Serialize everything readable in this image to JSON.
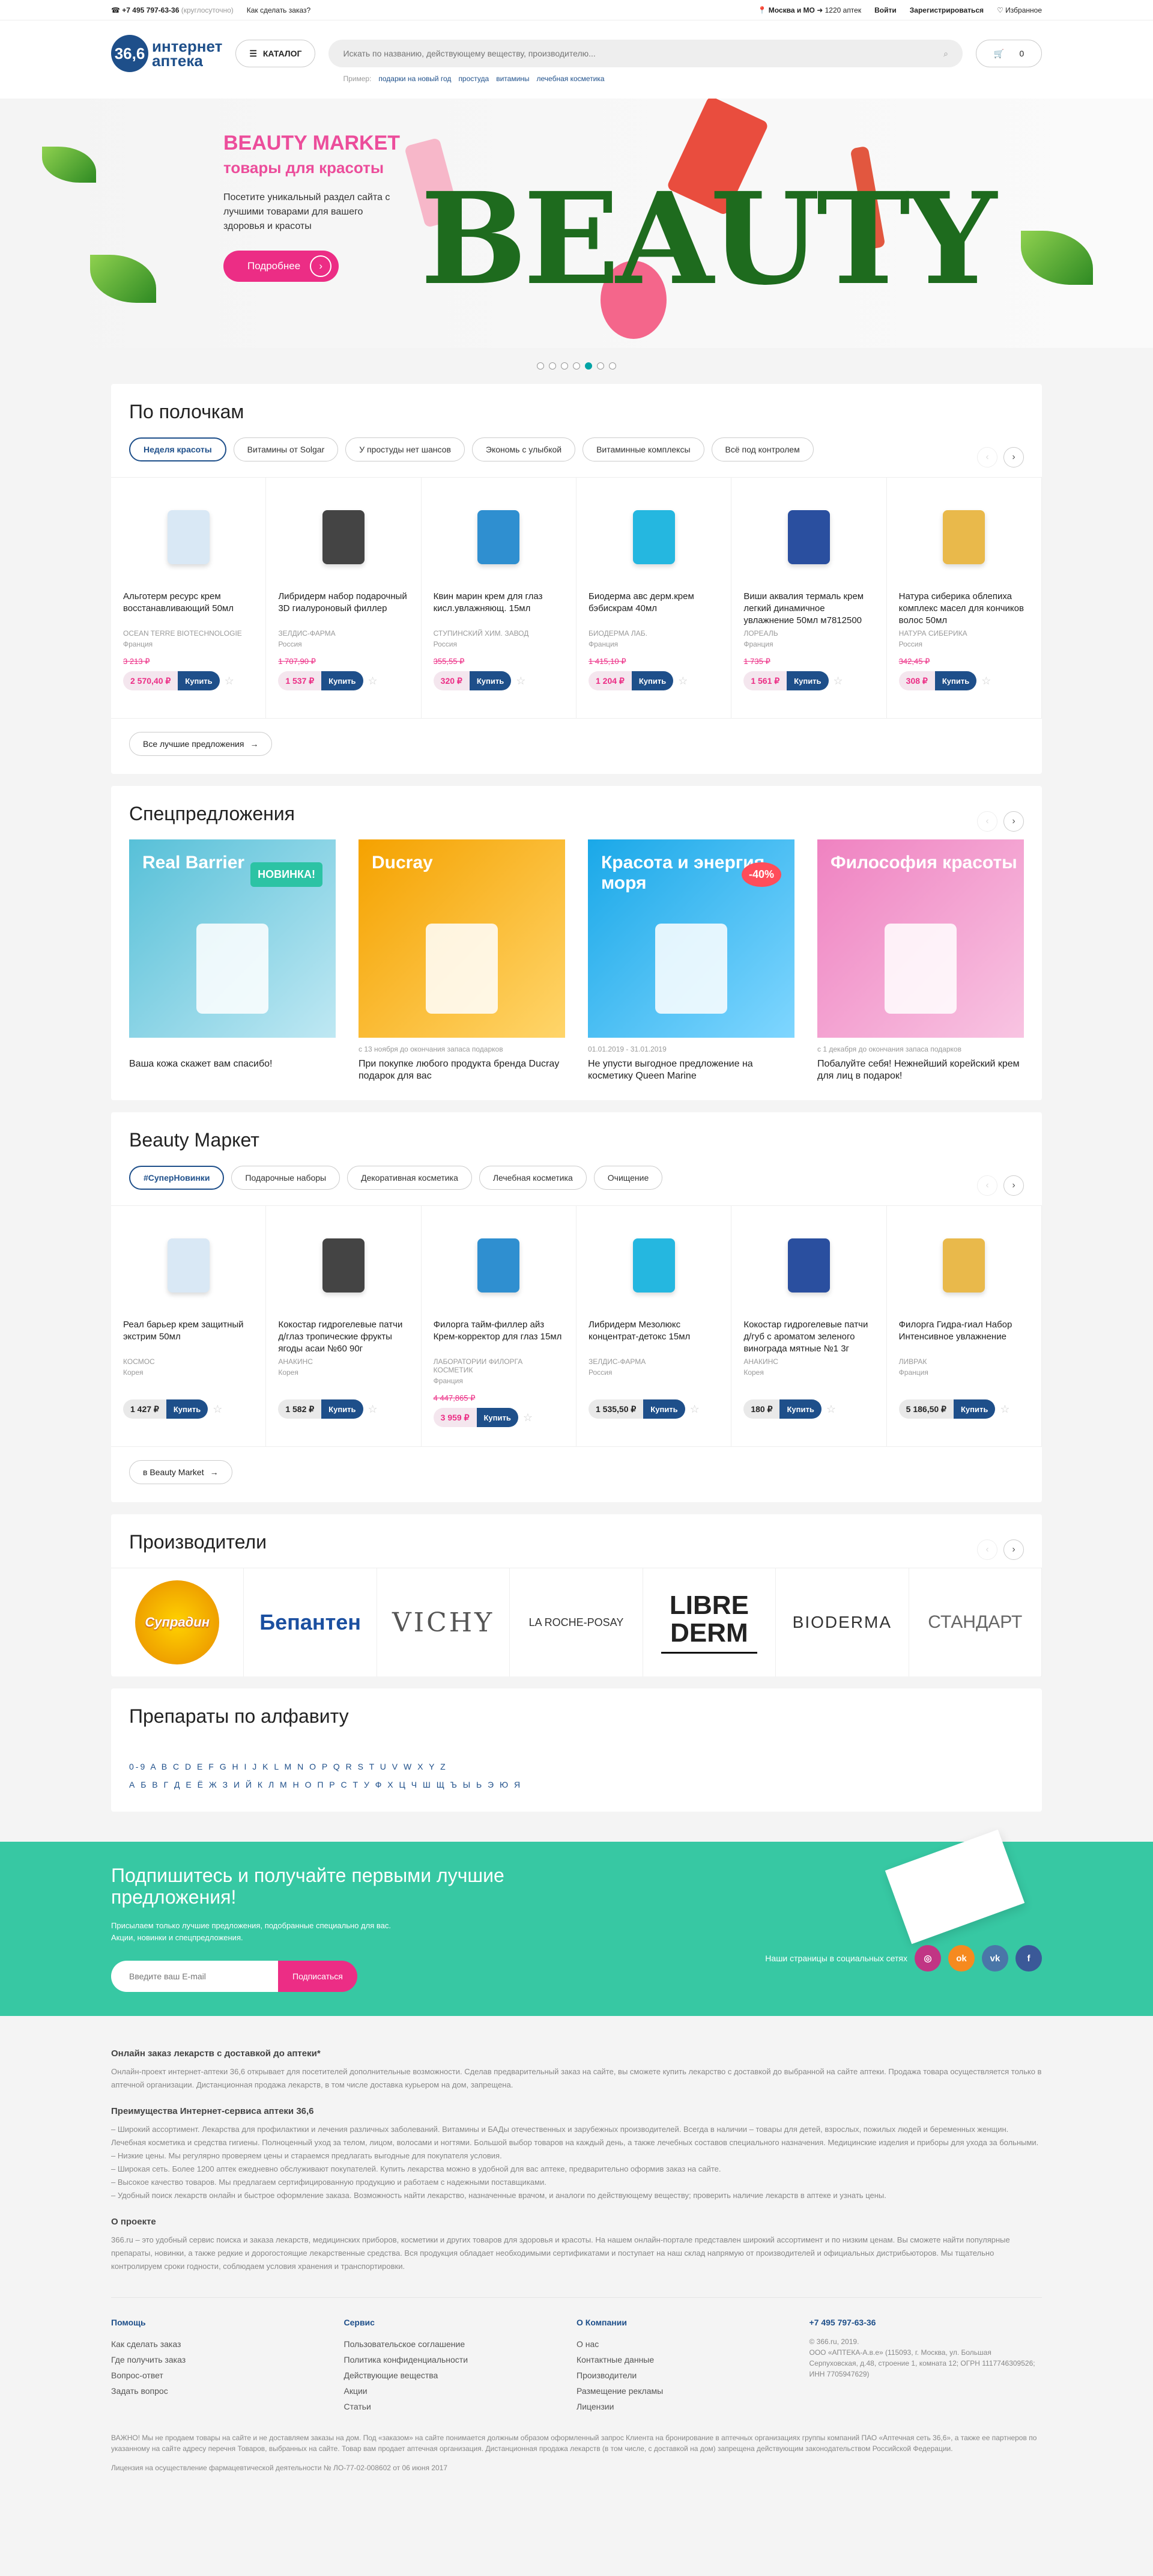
{
  "topbar": {
    "phone": "+7 495 797-63-36",
    "phone_note": "(круглосуточно)",
    "how_to_order": "Как сделать заказ?",
    "region": "Москва и МО",
    "pharmacies": "1220 аптек",
    "login": "Войти",
    "register": "Зарегистрироваться",
    "favorites": "Избранное"
  },
  "header": {
    "logo_num": "36,6",
    "logo_line1": "интернет",
    "logo_line2": "аптека",
    "catalog": "КАТАЛОГ",
    "search_placeholder": "Искать по названию, действующему веществу, производителю...",
    "hint_label": "Пример:",
    "hints": [
      "подарки на новый год",
      "простуда",
      "витамины",
      "лечебная косметика"
    ],
    "cart_count": "0"
  },
  "banner": {
    "title": "BEAUTY MARKET",
    "subtitle": "товары для красоты",
    "text": "Посетите уникальный раздел сайта с лучшими товарами для вашего здоровья и красоты",
    "button": "Подробнее",
    "word": "BEAUTY",
    "slides": 7,
    "active_slide": 5
  },
  "shelves": {
    "title": "По полочкам",
    "tabs": [
      "Неделя красоты",
      "Витамины от Solgar",
      "У простуды нет шансов",
      "Экономь с улыбкой",
      "Витаминные комплексы",
      "Всё под контролем"
    ],
    "products": [
      {
        "name": "Альготерм ресурс крем восстанавливающий 50мл",
        "mfr": "OCEAN TERRE BIOTECHNOLOGIE",
        "country": "Франция",
        "old": "3 213 ₽",
        "price": "2 570,40 ₽",
        "sale": true
      },
      {
        "name": "Либридерм набор подарочный 3D гиалуроновый филлер",
        "mfr": "ЗЕЛДИС-ФАРМА",
        "country": "Россия",
        "old": "1 707,90 ₽",
        "price": "1 537 ₽",
        "sale": true
      },
      {
        "name": "Квин марин крем для глаз кисл.увлажняющ. 15мл",
        "mfr": "СТУПИНСКИЙ ХИМ. ЗАВОД",
        "country": "Россия",
        "old": "355,55 ₽",
        "price": "320 ₽",
        "sale": true
      },
      {
        "name": "Биодерма авс дерм.крем бэбискрам 40мл",
        "mfr": "БИОДЕРМА ЛАБ.",
        "country": "Франция",
        "old": "1 415,10 ₽",
        "price": "1 204 ₽",
        "sale": true
      },
      {
        "name": "Виши аквалия термаль крем легкий динамичное увлажнение 50мл м7812500",
        "mfr": "ЛОРЕАЛЬ",
        "country": "Франция",
        "old": "1 735 ₽",
        "price": "1 561 ₽",
        "sale": true
      },
      {
        "name": "Натура сиберика облепиха комплекс масел для кончиков волос 50мл",
        "mfr": "НАТУРА СИБЕРИКА",
        "country": "Россия",
        "old": "342,45 ₽",
        "price": "308 ₽",
        "sale": true
      }
    ],
    "more": "Все лучшие предложения"
  },
  "offers": {
    "title": "Спецпредложения",
    "items": [
      {
        "pic_title": "Real Barrier",
        "badge": "НОВИНКА!",
        "date": "",
        "caption": "Ваша кожа скажет вам спасибо!",
        "color1": "#57c0d8",
        "color2": "#bfe8f3"
      },
      {
        "pic_title": "Ducray",
        "badge": "",
        "date": "с 13 ноября до окончания запаса подарков",
        "caption": "При покупке любого продукта бренда Ducray подарок для вас",
        "color1": "#f5a200",
        "color2": "#ffd56a"
      },
      {
        "pic_title": "Красота и энергия моря",
        "badge": "-40%",
        "date": "01.01.2019 - 31.01.2019",
        "caption": "Не упусти выгодное предложение на косметику Queen Marine",
        "color1": "#1aa8e8",
        "color2": "#7fd6ff"
      },
      {
        "pic_title": "Философия красоты",
        "badge": "",
        "date": "с 1 декабря до окончания запаса подарков",
        "caption": "Побалуйте себя! Нежнейший корейский крем для лиц в подарок!",
        "color1": "#ef82c1",
        "color2": "#f8c4e2"
      }
    ]
  },
  "beauty": {
    "title": "Beauty Маркет",
    "tabs": [
      "#СуперНовинки",
      "Подарочные наборы",
      "Декоративная косметика",
      "Лечебная косметика",
      "Очищение"
    ],
    "products": [
      {
        "name": "Реал барьер крем защитный экстрим 50мл",
        "mfr": "Космос",
        "country": "Корея",
        "old": "",
        "price": "1 427 ₽",
        "sale": false
      },
      {
        "name": "Кокостар гидрогелевые патчи д/глаз тропические фрукты ягоды асаи №60 90г",
        "mfr": "Анакинс",
        "country": "Корея",
        "old": "",
        "price": "1 582 ₽",
        "sale": false
      },
      {
        "name": "Филорга тайм-филлер айз Крем-корректор для глаз 15мл",
        "mfr": "Лаборатории Филорга Косметик",
        "country": "Франция",
        "old": "4 447,865 ₽",
        "price": "3 959 ₽",
        "sale": true
      },
      {
        "name": "Либридерм Мезолюкс концентрат-детокс 15мл",
        "mfr": "ЗЕЛДИС-ФАРМА",
        "country": "Россия",
        "old": "",
        "price": "1 535,50 ₽",
        "sale": false
      },
      {
        "name": "Кокостар гидрогелевые патчи д/губ с ароматом зеленого винограда мятные №1 3г",
        "mfr": "Анакинс",
        "country": "Корея",
        "old": "",
        "price": "180 ₽",
        "sale": false
      },
      {
        "name": "Филорга Гидра-гиал Набор Интенсивное увлажнение",
        "mfr": "ЛИВРАК",
        "country": "Франция",
        "old": "",
        "price": "5 186,50 ₽",
        "sale": false
      }
    ],
    "more": "в Beauty Market"
  },
  "brands": {
    "title": "Производители",
    "items": [
      "Супрадин",
      "Бепантен",
      "VICHY",
      "LA ROCHE-POSAY",
      "LIBRE DERM",
      "BIODERMA",
      "СТАНДАРТ"
    ]
  },
  "alphabet": {
    "title": "Препараты по алфавиту",
    "latin": "0-9 A B C D E F G H I J K L M N O P Q R S T U V W X Y Z",
    "cyrillic": "А Б В Г Д Е Ё Ж З И Й К Л М Н О П Р С Т У Ф Х Ц Ч Ш Щ Ъ Ы Ь Э Ю Я"
  },
  "subscribe": {
    "title": "Подпишитесь и получайте первыми лучшие предложения!",
    "text1": "Присылаем только лучшие предложения, подобранные специально для вас.",
    "text2": "Акции, новинки и спецпредложения.",
    "placeholder": "Введите ваш E-mail",
    "button": "Подписаться",
    "social_label": "Наши страницы в социальных сетях"
  },
  "footer": {
    "h1": "Онлайн заказ лекарств с доставкой до аптеки*",
    "p1": "Онлайн-проект интернет-аптеки 36,6 открывает для посетителей дополнительные возможности. Сделав предварительный заказ на сайте, вы сможете купить лекарство с доставкой до выбранной на сайте аптеки. Продажа товара осуществляется только в аптечной организации. Дистанционная продажа лекарств, в том числе доставка курьером на дом, запрещена.",
    "h2": "Преимущества Интернет-сервиса аптеки 36,6",
    "bullets": [
      "Широкий ассортимент. Лекарства для профилактики и лечения различных заболеваний. Витамины и БАДы отечественных и зарубежных производителей. Всегда в наличии – товары для детей, взрослых, пожилых людей и беременных женщин. Лечебная косметика и средства гигиены. Полноценный уход за телом, лицом, волосами и ногтями. Большой выбор товаров на каждый день, а также лечебных составов специального назначения. Медицинские изделия и приборы для ухода за больными.",
      "Низкие цены. Мы регулярно проверяем цены и стараемся предлагать выгодные для покупателя условия.",
      "Широкая сеть. Более 1200 аптек ежедневно обслуживают покупателей. Купить лекарства можно в удобной для вас аптеке, предварительно оформив заказ на сайте.",
      "Высокое качество товаров. Мы предлагаем сертифицированную продукцию и работаем с надежными поставщиками.",
      "Удобный поиск лекарств онлайн и быстрое оформление заказа. Возможность найти лекарство, назначенные врачом, и аналоги по действующему веществу; проверить наличие лекарств в аптеке и узнать цены."
    ],
    "h3": "О проекте",
    "p3": "366.ru – это удобный сервис поиска и заказа лекарств, медицинских приборов, косметики и других товаров для здоровья и красоты. На нашем онлайн-портале представлен широкий ассортимент и по низким ценам. Вы сможете найти популярные препараты, новинки, а также редкие и дорогостоящие лекарственные средства. Вся продукция обладает необходимыми сертификатами и поступает на наш склад напрямую от производителей и официальных дистрибьюторов. Мы тщательно контролируем сроки годности, соблюдаем условия хранения и транспортировки.",
    "cols": [
      {
        "title": "Помощь",
        "links": [
          "Как сделать заказ",
          "Где получить заказ",
          "Вопрос-ответ",
          "Задать вопрос"
        ]
      },
      {
        "title": "Сервис",
        "links": [
          "Пользовательское соглашение",
          "Политика конфиденциальности",
          "Действующие вещества",
          "Акции",
          "Статьи"
        ]
      },
      {
        "title": "О Компании",
        "links": [
          "О нас",
          "Контактные данные",
          "Производители",
          "Размещение рекламы",
          "Лицензии"
        ]
      },
      {
        "title": "+7 495 797-63-36",
        "links": [
          "© 366.ru, 2019.",
          "ООО «АПТЕКА-А.в.е» (115093, г. Москва, ул. Большая Серпуховская, д.48, строение 1, комната 12; ОГРН 1117746309526; ИНН 7705947629)"
        ]
      }
    ],
    "legal1": "ВАЖНО! Мы не продаем товары на сайте и не доставляем заказы на дом. Под «заказом» на сайте понимается должным образом оформленный запрос Клиента на бронирование в аптечных организациях группы компаний ПАО «Аптечная сеть 36,6», а также ее партнеров по указанному на сайте адресу перечня Товаров, выбранных на сайте. Товар вам продает аптечная организация. Дистанционная продажа лекарств (в том числе, с доставкой на дом) запрещена действующим законодательством Российской Федерации.",
    "legal2": "Лицензия на осуществление фармацевтической деятельности № ЛО-77-02-008602 от 06 июня 2017"
  }
}
